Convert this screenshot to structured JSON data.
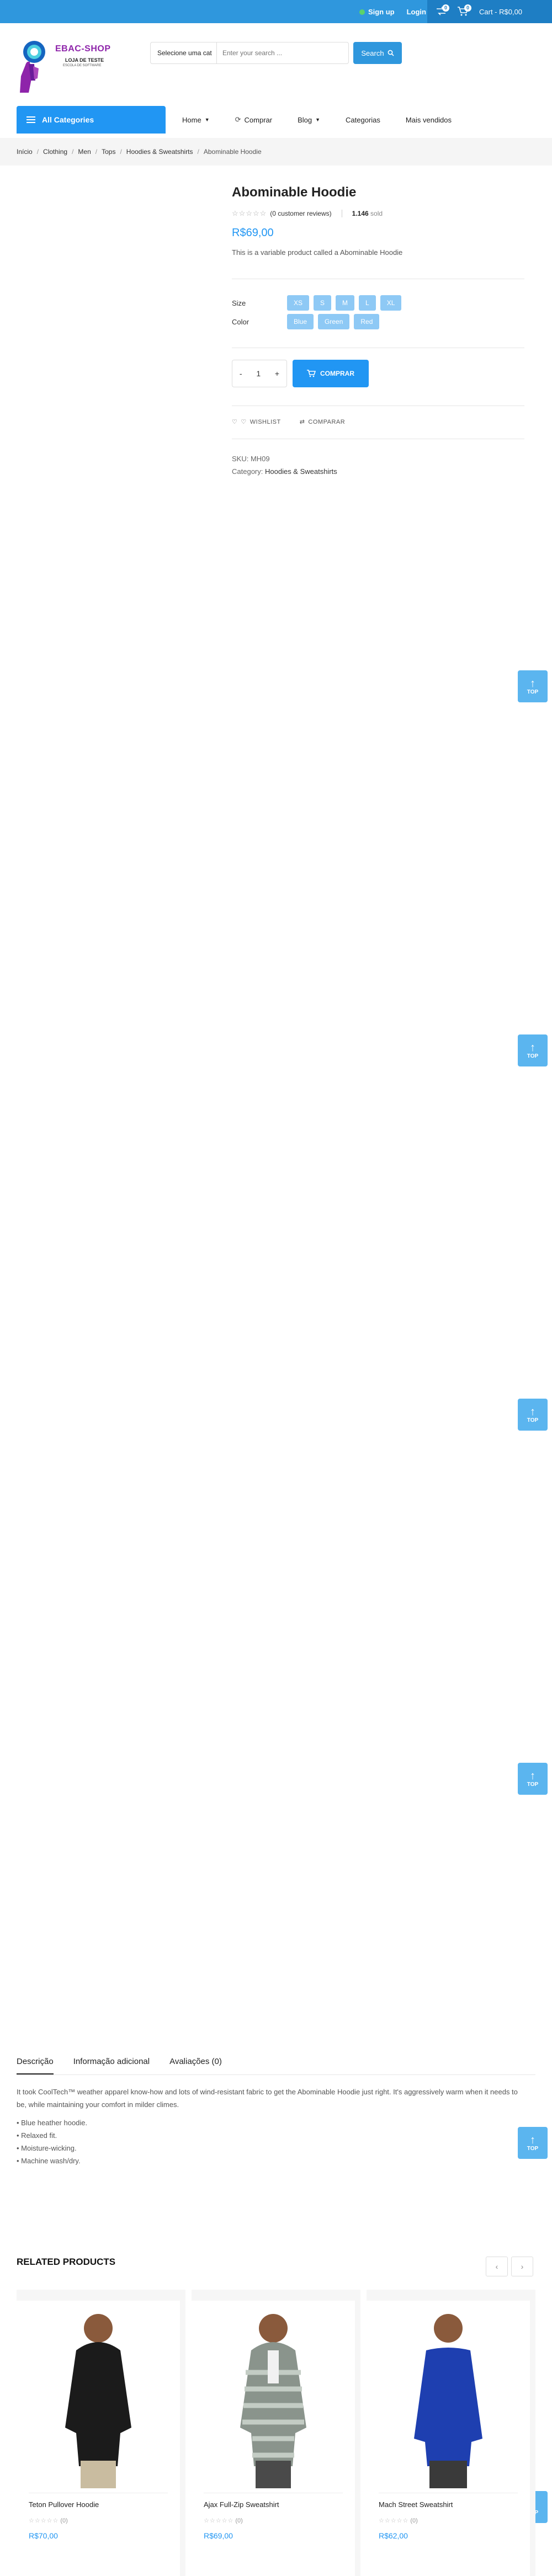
{
  "topbar": {
    "signup": "Sign up",
    "login": "Login",
    "cart_count_1": "0",
    "cart_count_2": "0",
    "cart_label": "Cart - R$0,00"
  },
  "logo": {
    "brand": "EBAC-SHOP",
    "line1": "LOJA DE TESTE",
    "line2": "ESCOLA DE SOFTWARE"
  },
  "search": {
    "category": "Selecione uma cat",
    "placeholder": "Enter your search ...",
    "button": "Search"
  },
  "nav": {
    "all_categories": "All Categories",
    "items": [
      "Home",
      "Comprar",
      "Blog",
      "Categorias",
      "Mais vendidos"
    ]
  },
  "breadcrumb": [
    "Início",
    "Clothing",
    "Men",
    "Tops",
    "Hoodies & Sweatshirts",
    "Abominable Hoodie"
  ],
  "product": {
    "title": "Abominable Hoodie",
    "reviews": "(0 customer reviews)",
    "sold_count": "1.146",
    "sold_label": "sold",
    "price": "R$69,00",
    "short_desc": "This is a variable product called a Abominable Hoodie",
    "size_label": "Size",
    "sizes": [
      "XS",
      "S",
      "M",
      "L",
      "XL"
    ],
    "color_label": "Color",
    "colors": [
      "Blue",
      "Green",
      "Red"
    ],
    "qty_minus": "-",
    "qty_value": "1",
    "qty_plus": "+",
    "buy_button": "COMPRAR",
    "wishlist": "WISHLIST",
    "compare": "COMPARAR",
    "sku_label": "SKU:",
    "sku": "MH09",
    "category_label": "Category:",
    "category": "Hoodies & Sweatshirts"
  },
  "to_top": {
    "label": "TOP"
  },
  "tabs": {
    "items": [
      "Descrição",
      "Informação adicional",
      "Avaliações (0)"
    ]
  },
  "description": {
    "text": "It took CoolTech™ weather apparel know-how and lots of wind-resistant fabric to get the Abominable Hoodie just right. It's aggressively warm when it needs to be, while maintaining your comfort in milder climes.",
    "bullets": [
      "• Blue heather hoodie.",
      "• Relaxed fit.",
      "• Moisture-wicking.",
      "• Machine wash/dry."
    ]
  },
  "related": {
    "title": "RELATED PRODUCTS",
    "prev": "‹",
    "next": "›",
    "products": [
      {
        "name": "Teton Pullover Hoodie",
        "reviews": "(0)",
        "price": "R$70,00"
      },
      {
        "name": "Ajax Full-Zip Sweatshirt",
        "reviews": "(0)",
        "price": "R$69,00"
      },
      {
        "name": "Mach Street Sweatshirt",
        "reviews": "(0)",
        "price": "R$62,00"
      }
    ]
  },
  "colors": {
    "primary": "#2196f3",
    "topbar": "#2f97dd",
    "pill": "#8ec9f5",
    "brand": "#8e24aa"
  }
}
